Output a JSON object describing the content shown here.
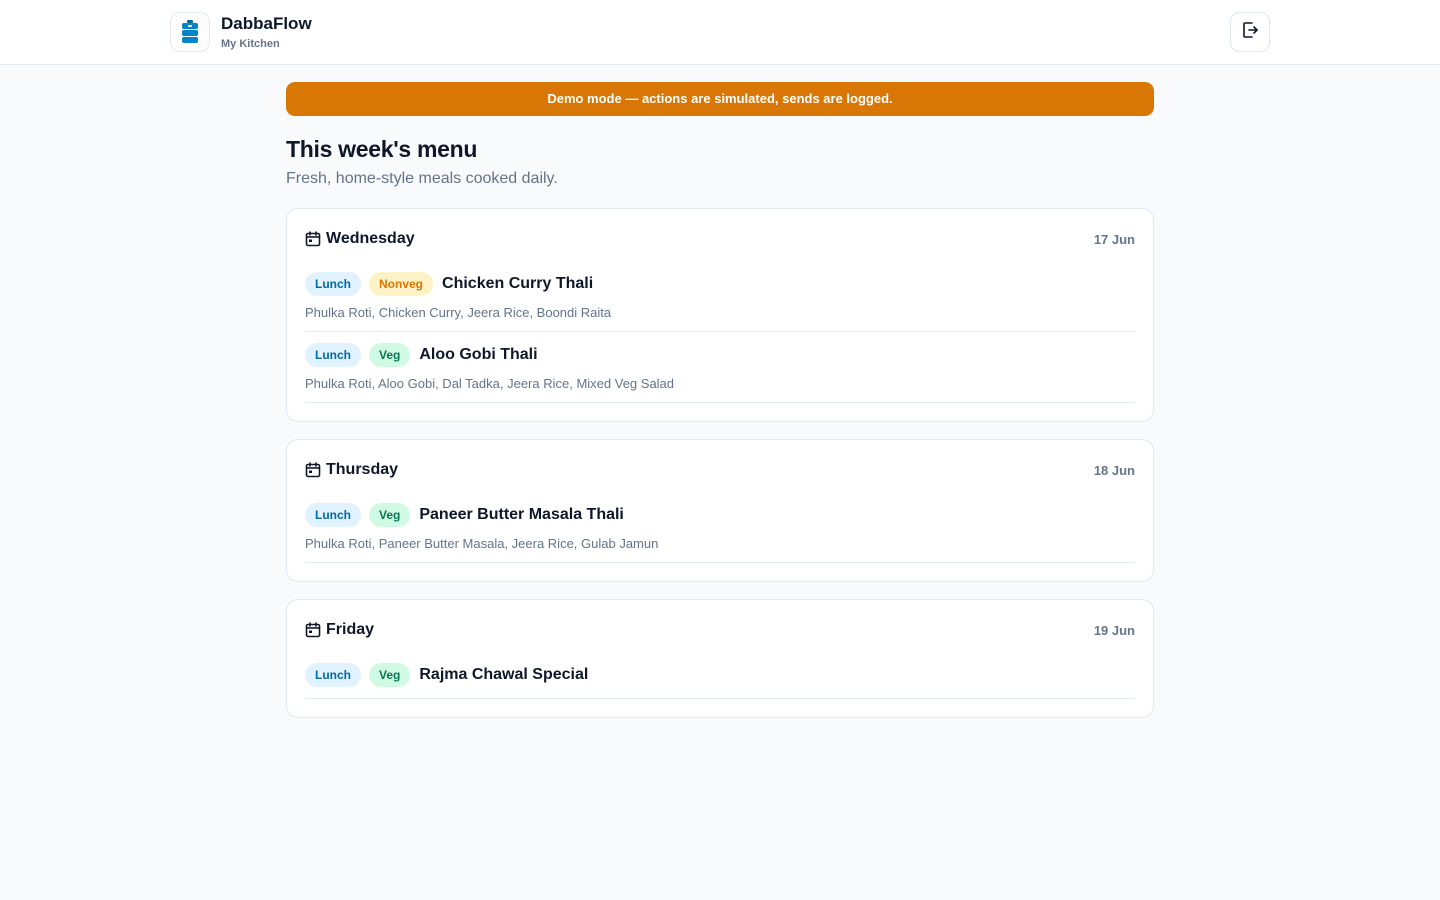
{
  "app": {
    "name": "DabbaFlow",
    "subtitle": "My Kitchen",
    "logo_icon": "tiffin-box-icon",
    "logout_icon": "logout-icon"
  },
  "banner": {
    "text": "Demo mode — actions are simulated, sends are logged.",
    "color": "#d97706"
  },
  "page": {
    "title": "This week's menu",
    "subtitle": "Fresh, home-style meals cooked daily."
  },
  "days": [
    {
      "name": "Wednesday",
      "date": "17 Jun",
      "meals": [
        {
          "type": "Lunch",
          "diet": "Nonveg",
          "diet_kind": "nonveg",
          "name": "Chicken Curry Thali",
          "items": "Phulka Roti, Chicken Curry, Jeera Rice, Boondi Raita"
        },
        {
          "type": "Lunch",
          "diet": "Veg",
          "diet_kind": "veg",
          "name": "Aloo Gobi Thali",
          "items": "Phulka Roti, Aloo Gobi, Dal Tadka, Jeera Rice, Mixed Veg Salad"
        }
      ]
    },
    {
      "name": "Thursday",
      "date": "18 Jun",
      "meals": [
        {
          "type": "Lunch",
          "diet": "Veg",
          "diet_kind": "veg",
          "name": "Paneer Butter Masala Thali",
          "items": "Phulka Roti, Paneer Butter Masala, Jeera Rice, Gulab Jamun"
        }
      ]
    },
    {
      "name": "Friday",
      "date": "19 Jun",
      "meals": [
        {
          "type": "Lunch",
          "diet": "Veg",
          "diet_kind": "veg",
          "name": "Rajma Chawal Special",
          "items": ""
        }
      ]
    }
  ],
  "colors": {
    "accent": "#0284c7",
    "banner": "#d97706",
    "veg_chip_bg": "#d1fae5",
    "nonveg_chip_bg": "#fef3c7",
    "meal_chip_bg": "#e0f2fe"
  }
}
